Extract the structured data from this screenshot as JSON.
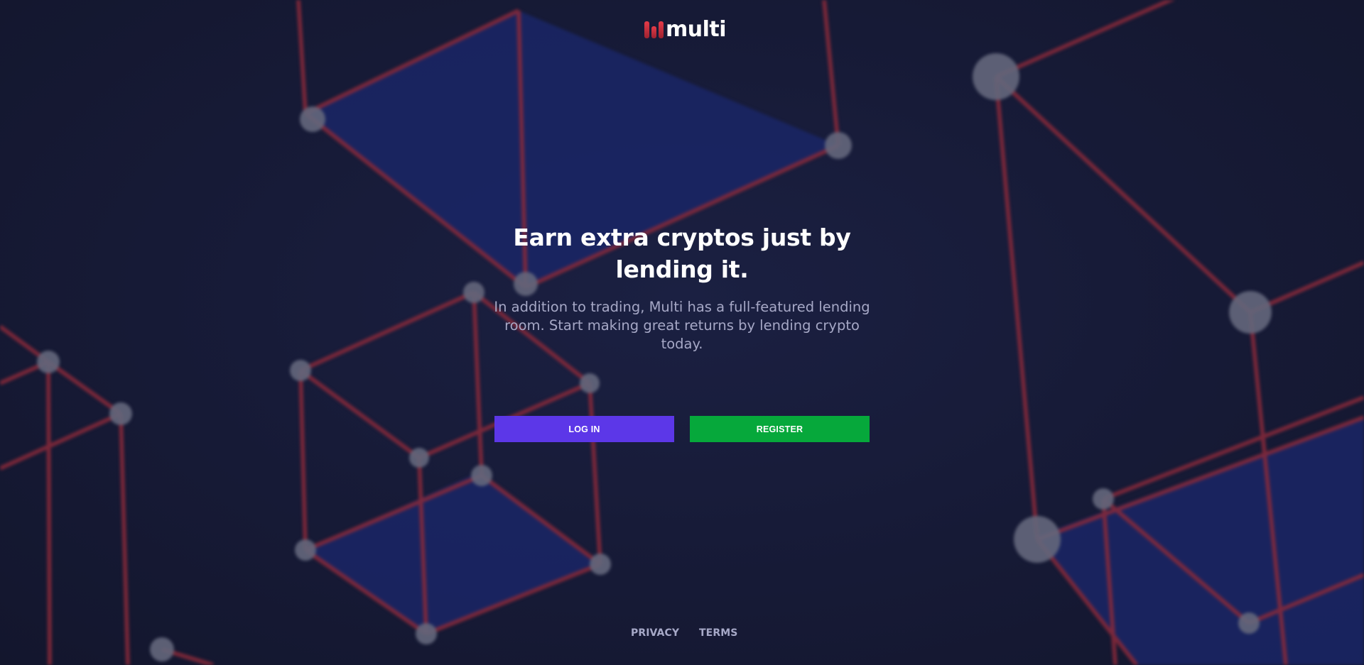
{
  "brand": {
    "name": "multi",
    "accent": "#e03a46"
  },
  "hero": {
    "headline": "Earn extra cryptos just by lending it.",
    "subtext": "In addition to trading, Multi has a full-featured lending room. Start making great returns by lending crypto today."
  },
  "actions": {
    "login_label": "LOG IN",
    "register_label": "REGISTER",
    "login_color": "#5c37e8",
    "register_color": "#06a83b"
  },
  "footer": {
    "privacy_label": "PRIVACY",
    "terms_label": "TERMS"
  },
  "background": {
    "base_color": "#161a33",
    "panel_color": "#1a2666",
    "edge_color": "#8a2a3a",
    "node_color": "#64677c"
  }
}
